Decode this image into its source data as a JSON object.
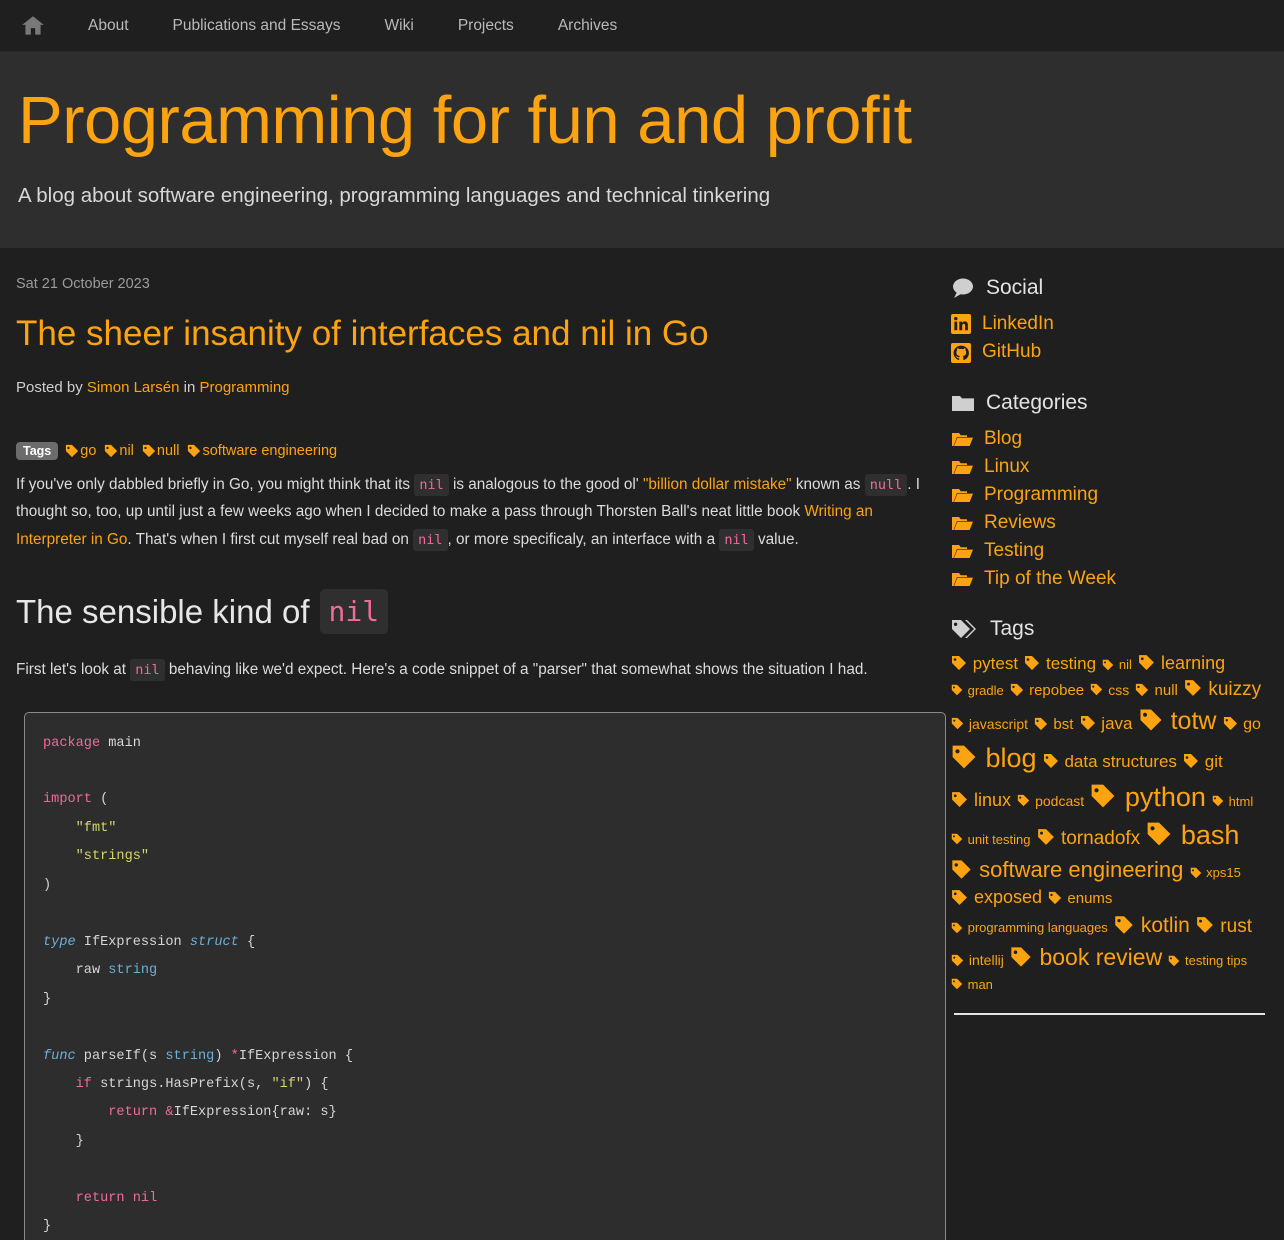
{
  "navbar": {
    "home_icon": "home-icon",
    "links": [
      {
        "label": "About"
      },
      {
        "label": "Publications and Essays"
      },
      {
        "label": "Wiki"
      },
      {
        "label": "Projects"
      },
      {
        "label": "Archives"
      }
    ]
  },
  "header": {
    "title": "Programming for fun and profit",
    "tagline": "A blog about software engineering, programming languages and technical tinkering"
  },
  "post": {
    "date": "Sat 21 October 2023",
    "title": "The sheer insanity of interfaces and nil in Go",
    "byline_prefix": "Posted by",
    "author": "Simon Larsén",
    "byline_middle": "in",
    "category": "Programming",
    "tags_badge": "Tags",
    "tags": [
      "go",
      "nil",
      "null",
      "software engineering"
    ],
    "intro": {
      "part1": "If you've only dabbled briefly in Go, you might think that its",
      "code1": "nil",
      "part2": "is analogous to the good ol'",
      "link1": "\"billion dollar mistake\"",
      "part3": "known as",
      "code2": "null",
      "part4": ". I thought so, too, up until just a few weeks ago when I decided to make a pass through Thorsten Ball's neat little book",
      "link2": "Writing an Interpreter in Go",
      "part5": ". That's when I first cut myself real bad on",
      "code3": "nil",
      "part6": ", or more specificaly, an interface with a",
      "code4": "nil",
      "part7": "value."
    },
    "section_heading": {
      "text": "The sensible kind of",
      "code": "nil"
    },
    "section_intro": {
      "part1": "First let's look at",
      "code1": "nil",
      "part2": "behaving like we'd expect. Here's a code snippet of a \"parser\" that somewhat shows the situation I had."
    },
    "code_language": "go"
  },
  "sidebar": {
    "social": {
      "title": "Social",
      "icon": "speech-bubble-icon",
      "links": [
        {
          "label": "LinkedIn",
          "icon": "linkedin-icon"
        },
        {
          "label": "GitHub",
          "icon": "github-icon"
        }
      ]
    },
    "categories": {
      "title": "Categories",
      "icon": "folder-icon",
      "items": [
        {
          "label": "Blog",
          "icon": "folder-open-icon"
        },
        {
          "label": "Linux",
          "icon": "folder-open-icon"
        },
        {
          "label": "Programming",
          "icon": "folder-open-icon"
        },
        {
          "label": "Reviews",
          "icon": "folder-open-icon"
        },
        {
          "label": "Testing",
          "icon": "folder-open-icon"
        },
        {
          "label": "Tip of the Week",
          "icon": "folder-open-icon"
        }
      ]
    },
    "tags": {
      "title": "Tags",
      "icon": "tags-icon",
      "cloud": [
        {
          "label": "pytest",
          "size": 17
        },
        {
          "label": "testing",
          "size": 17
        },
        {
          "label": "nil",
          "size": 13
        },
        {
          "label": "learning",
          "size": 18
        },
        {
          "label": "gradle",
          "size": 13
        },
        {
          "label": "repobee",
          "size": 15
        },
        {
          "label": "css",
          "size": 14
        },
        {
          "label": "null",
          "size": 15
        },
        {
          "label": "kuizzy",
          "size": 19
        },
        {
          "label": "javascript",
          "size": 14
        },
        {
          "label": "bst",
          "size": 15
        },
        {
          "label": "java",
          "size": 17
        },
        {
          "label": "totw",
          "size": 25
        },
        {
          "label": "go",
          "size": 16
        },
        {
          "label": "blog",
          "size": 27
        },
        {
          "label": "data structures",
          "size": 17
        },
        {
          "label": "git",
          "size": 17
        },
        {
          "label": "linux",
          "size": 18
        },
        {
          "label": "podcast",
          "size": 14
        },
        {
          "label": "python",
          "size": 27
        },
        {
          "label": "html",
          "size": 13
        },
        {
          "label": "unit testing",
          "size": 13
        },
        {
          "label": "tornadofx",
          "size": 19
        },
        {
          "label": "bash",
          "size": 27
        },
        {
          "label": "software engineering",
          "size": 22
        },
        {
          "label": "xps15",
          "size": 13
        },
        {
          "label": "exposed",
          "size": 18
        },
        {
          "label": "enums",
          "size": 15
        },
        {
          "label": "programming languages",
          "size": 13
        },
        {
          "label": "kotlin",
          "size": 21
        },
        {
          "label": "rust",
          "size": 19
        },
        {
          "label": "intellij",
          "size": 14
        },
        {
          "label": "book review",
          "size": 23
        },
        {
          "label": "testing tips",
          "size": 13
        },
        {
          "label": "man",
          "size": 13
        }
      ]
    }
  },
  "code": {
    "lines": [
      [
        [
          "k",
          "package"
        ],
        [
          "op",
          " main"
        ]
      ],
      [],
      [
        [
          "k",
          "import"
        ],
        [
          "op",
          " ("
        ]
      ],
      [
        [
          "op",
          "    "
        ],
        [
          "s",
          "\"fmt\""
        ]
      ],
      [
        [
          "op",
          "    "
        ],
        [
          "s",
          "\"strings\""
        ]
      ],
      [
        [
          "op",
          ")"
        ]
      ],
      [],
      [
        [
          "kt",
          "type"
        ],
        [
          "op",
          " IfExpression "
        ],
        [
          "kt",
          "struct"
        ],
        [
          "op",
          " {"
        ]
      ],
      [
        [
          "op",
          "    raw "
        ],
        [
          "ty",
          "string"
        ]
      ],
      [
        [
          "op",
          "}"
        ]
      ],
      [],
      [
        [
          "kt",
          "func"
        ],
        [
          "op",
          " parseIf(s "
        ],
        [
          "ty",
          "string"
        ],
        [
          "op",
          ") "
        ],
        [
          "k",
          "*"
        ],
        [
          "op",
          "IfExpression {"
        ]
      ],
      [
        [
          "op",
          "    "
        ],
        [
          "k",
          "if"
        ],
        [
          "op",
          " strings.HasPrefix(s, "
        ],
        [
          "s",
          "\"if\""
        ],
        [
          "op",
          ") {"
        ]
      ],
      [
        [
          "op",
          "        "
        ],
        [
          "k",
          "return"
        ],
        [
          "op",
          " "
        ],
        [
          "k",
          "&"
        ],
        [
          "op",
          "IfExpression{raw: s}"
        ]
      ],
      [
        [
          "op",
          "    }"
        ]
      ],
      [],
      [
        [
          "op",
          "    "
        ],
        [
          "k",
          "return"
        ],
        [
          "op",
          " "
        ],
        [
          "nil",
          "nil"
        ]
      ],
      [
        [
          "op",
          "}"
        ]
      ]
    ]
  },
  "colors": {
    "accent": "#fca311",
    "page_bg": "#1f1f1f",
    "header_bg": "#2e2e2e",
    "code_bg": "#2d2d2d",
    "inline_code_fg": "#f06a9b",
    "text": "#dcdcdc"
  }
}
